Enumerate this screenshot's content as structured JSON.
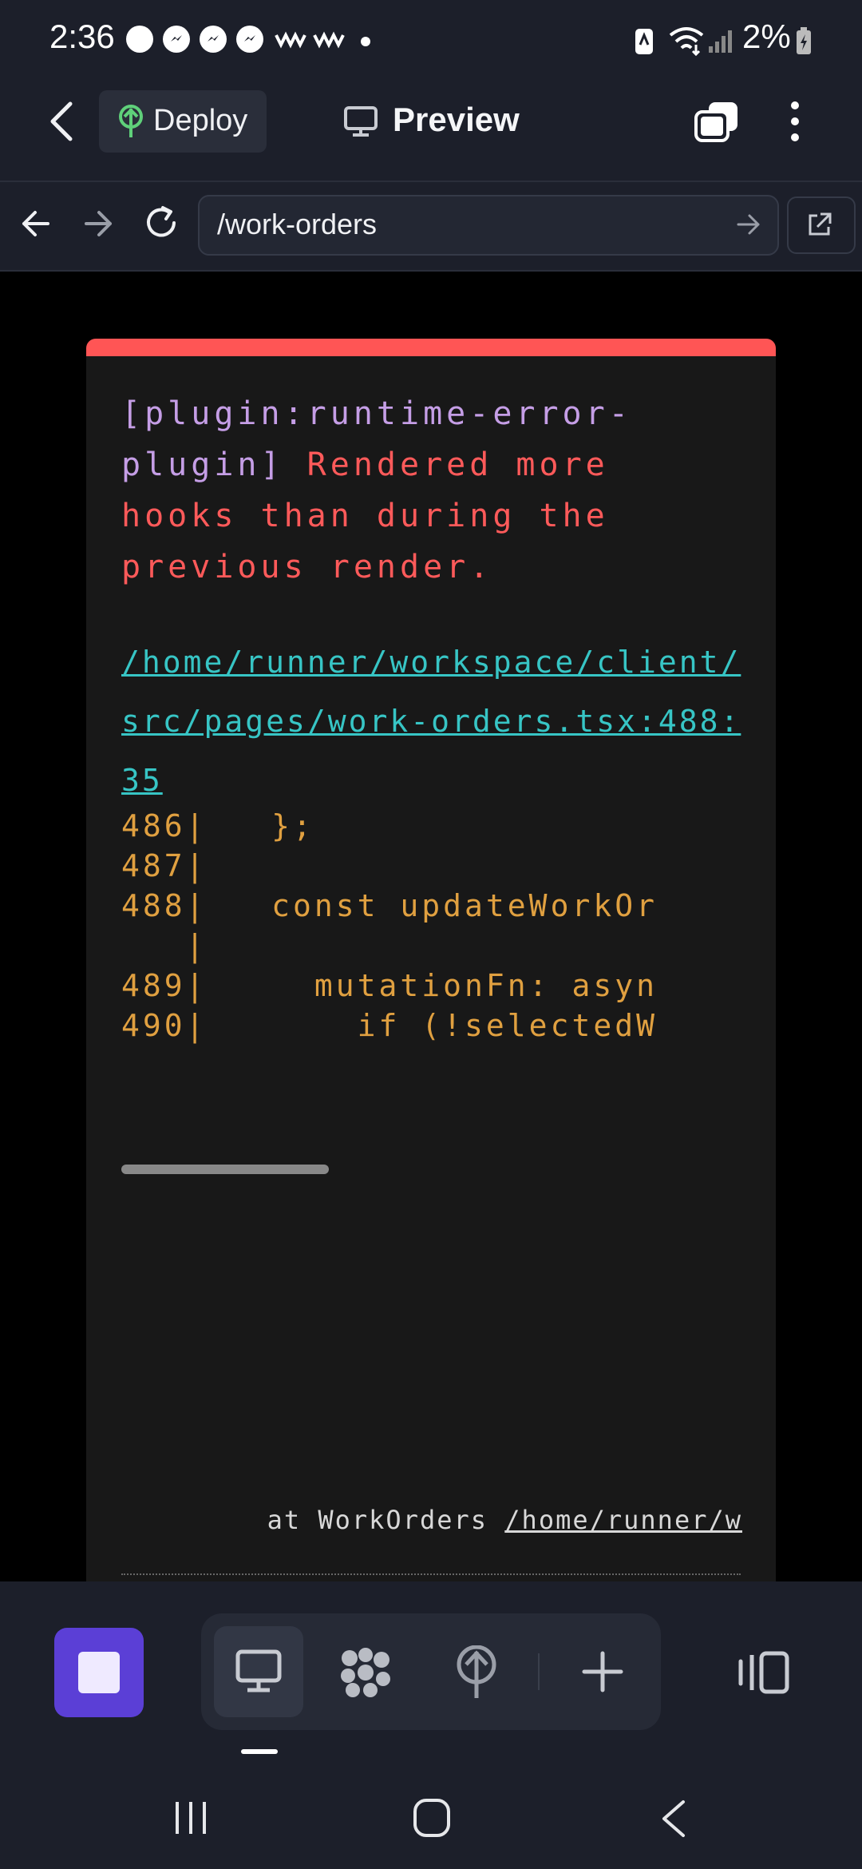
{
  "status_bar": {
    "time": "2:36",
    "battery": "2%",
    "icons": [
      "chat-icon",
      "messenger-icon",
      "messenger-icon",
      "messenger-icon",
      "wave-icon",
      "wave-icon",
      "dot-icon",
      "nfc-icon",
      "wifi-icon",
      "signal-icon",
      "battery-charging-icon"
    ]
  },
  "app_bar": {
    "deploy_label": "Deploy",
    "preview_label": "Preview"
  },
  "url_bar": {
    "url": "/work-orders"
  },
  "error": {
    "plugin": "[plugin:runtime-error-plugin]",
    "message": " Rendered more hooks than during the previous render.",
    "file": "/home/runner/workspace/client/src/pages/work-orders.tsx:488:35",
    "code_lines": [
      {
        "num": "486|",
        "code": "   };"
      },
      {
        "num": "487|",
        "code": ""
      },
      {
        "num": "488|",
        "code": "   const updateWorkOr"
      },
      {
        "num": "   |",
        "code": ""
      },
      {
        "num": "489|",
        "code": "     mutationFn: asyn"
      },
      {
        "num": "490|",
        "code": "       if (!selectedW"
      }
    ],
    "stack_prefix": "at WorkOrders ",
    "stack_path": "/home/runner/w"
  },
  "colors": {
    "accent": "#5b3fd6",
    "error_red": "#ff5555",
    "link_cyan": "#37c5c5",
    "code_orange": "#e0a040",
    "plugin_purple": "#c59ee6"
  }
}
